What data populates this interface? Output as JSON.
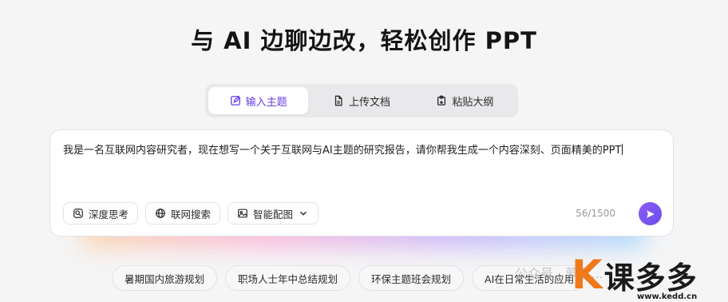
{
  "title": "与 AI 边聊边改，轻松创作 PPT",
  "tabs": [
    {
      "label": "输入主题",
      "icon": "edit-icon"
    },
    {
      "label": "上传文档",
      "icon": "document-icon"
    },
    {
      "label": "粘贴大纲",
      "icon": "paste-icon"
    }
  ],
  "prompt": {
    "value": "我是一名互联网内容研究者，现在想写一个关于互联网与AI主题的研究报告，请你帮我生成一个内容深刻、页面精美的PPT"
  },
  "options": {
    "deep_think": "深度思考",
    "web_search": "联网搜索",
    "image_config": "智能配图"
  },
  "counter": "56/1500",
  "suggestions": [
    "暑期国内旅游规划",
    "职场人士年中总结规划",
    "环保主题班会规划",
    "AI在日常生活的应用"
  ],
  "watermark": {
    "text": "公众号 · 萝卜...",
    "logo_letter": "K",
    "logo_text": "课多多",
    "logo_url": "www.kedd.cn"
  },
  "colors": {
    "accent": "#6a3ee8",
    "logo_orange": "#f07a1a"
  }
}
